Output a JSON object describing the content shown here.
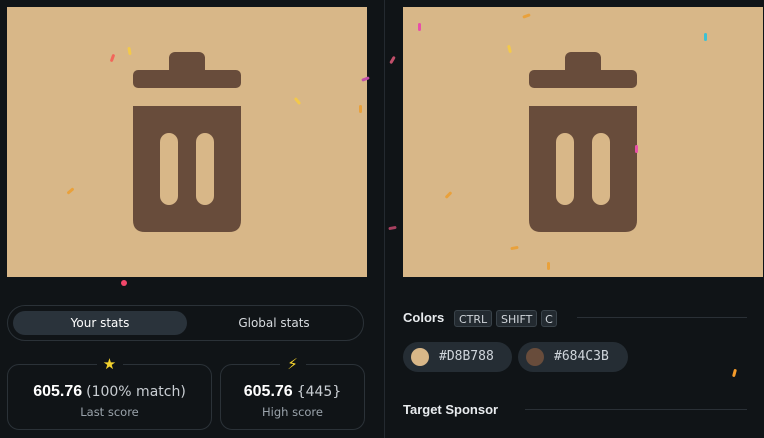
{
  "colors": {
    "background": "#101417",
    "canvas": "#D8B788",
    "icon": "#684C3B"
  },
  "canvas": {
    "left_icon": "trash-icon",
    "right_icon": "trash-icon"
  },
  "stats_tabs": {
    "your_stats": "Your stats",
    "global_stats": "Global stats"
  },
  "last_score": {
    "value": "605.76",
    "extra": "(100% match)",
    "label": "Last score",
    "icon": "star-icon"
  },
  "high_score": {
    "value": "605.76",
    "extra": "{445}",
    "label": "High score",
    "icon": "lightning-icon"
  },
  "colors_section": {
    "title": "Colors",
    "shortcut": [
      "CTRL",
      "SHIFT",
      "C"
    ],
    "chips": [
      {
        "hex": "#D8B788"
      },
      {
        "hex": "#684C3B"
      }
    ]
  },
  "sponsor_section": {
    "title": "Target Sponsor"
  }
}
